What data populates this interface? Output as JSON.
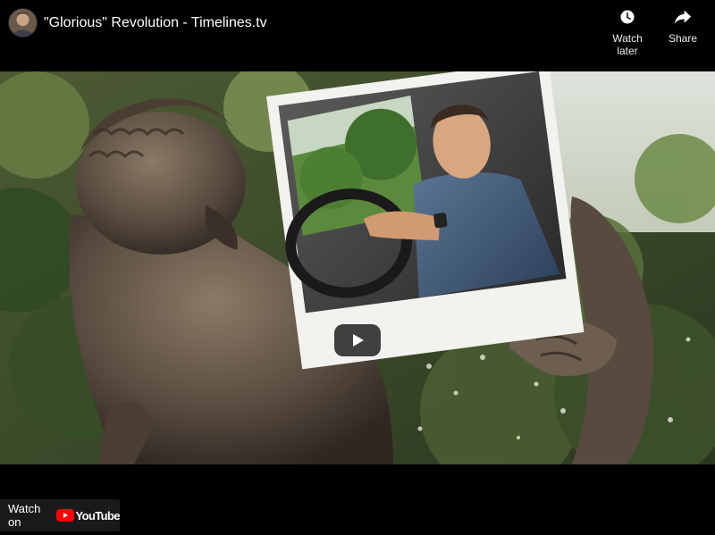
{
  "header": {
    "title": "\"Glorious\" Revolution - Timelines.tv",
    "channel_avatar": "channel-avatar"
  },
  "actions": {
    "watch_later": {
      "label": "Watch later",
      "icon": "clock-icon"
    },
    "share": {
      "label": "Share",
      "icon": "share-arrow-icon"
    }
  },
  "player": {
    "play_icon": "play-icon"
  },
  "footer": {
    "watch_on_label": "Watch on",
    "youtube_word": "YouTube"
  },
  "colors": {
    "background": "#000000",
    "play_button": "#212121",
    "youtube_red": "#FF0000"
  }
}
